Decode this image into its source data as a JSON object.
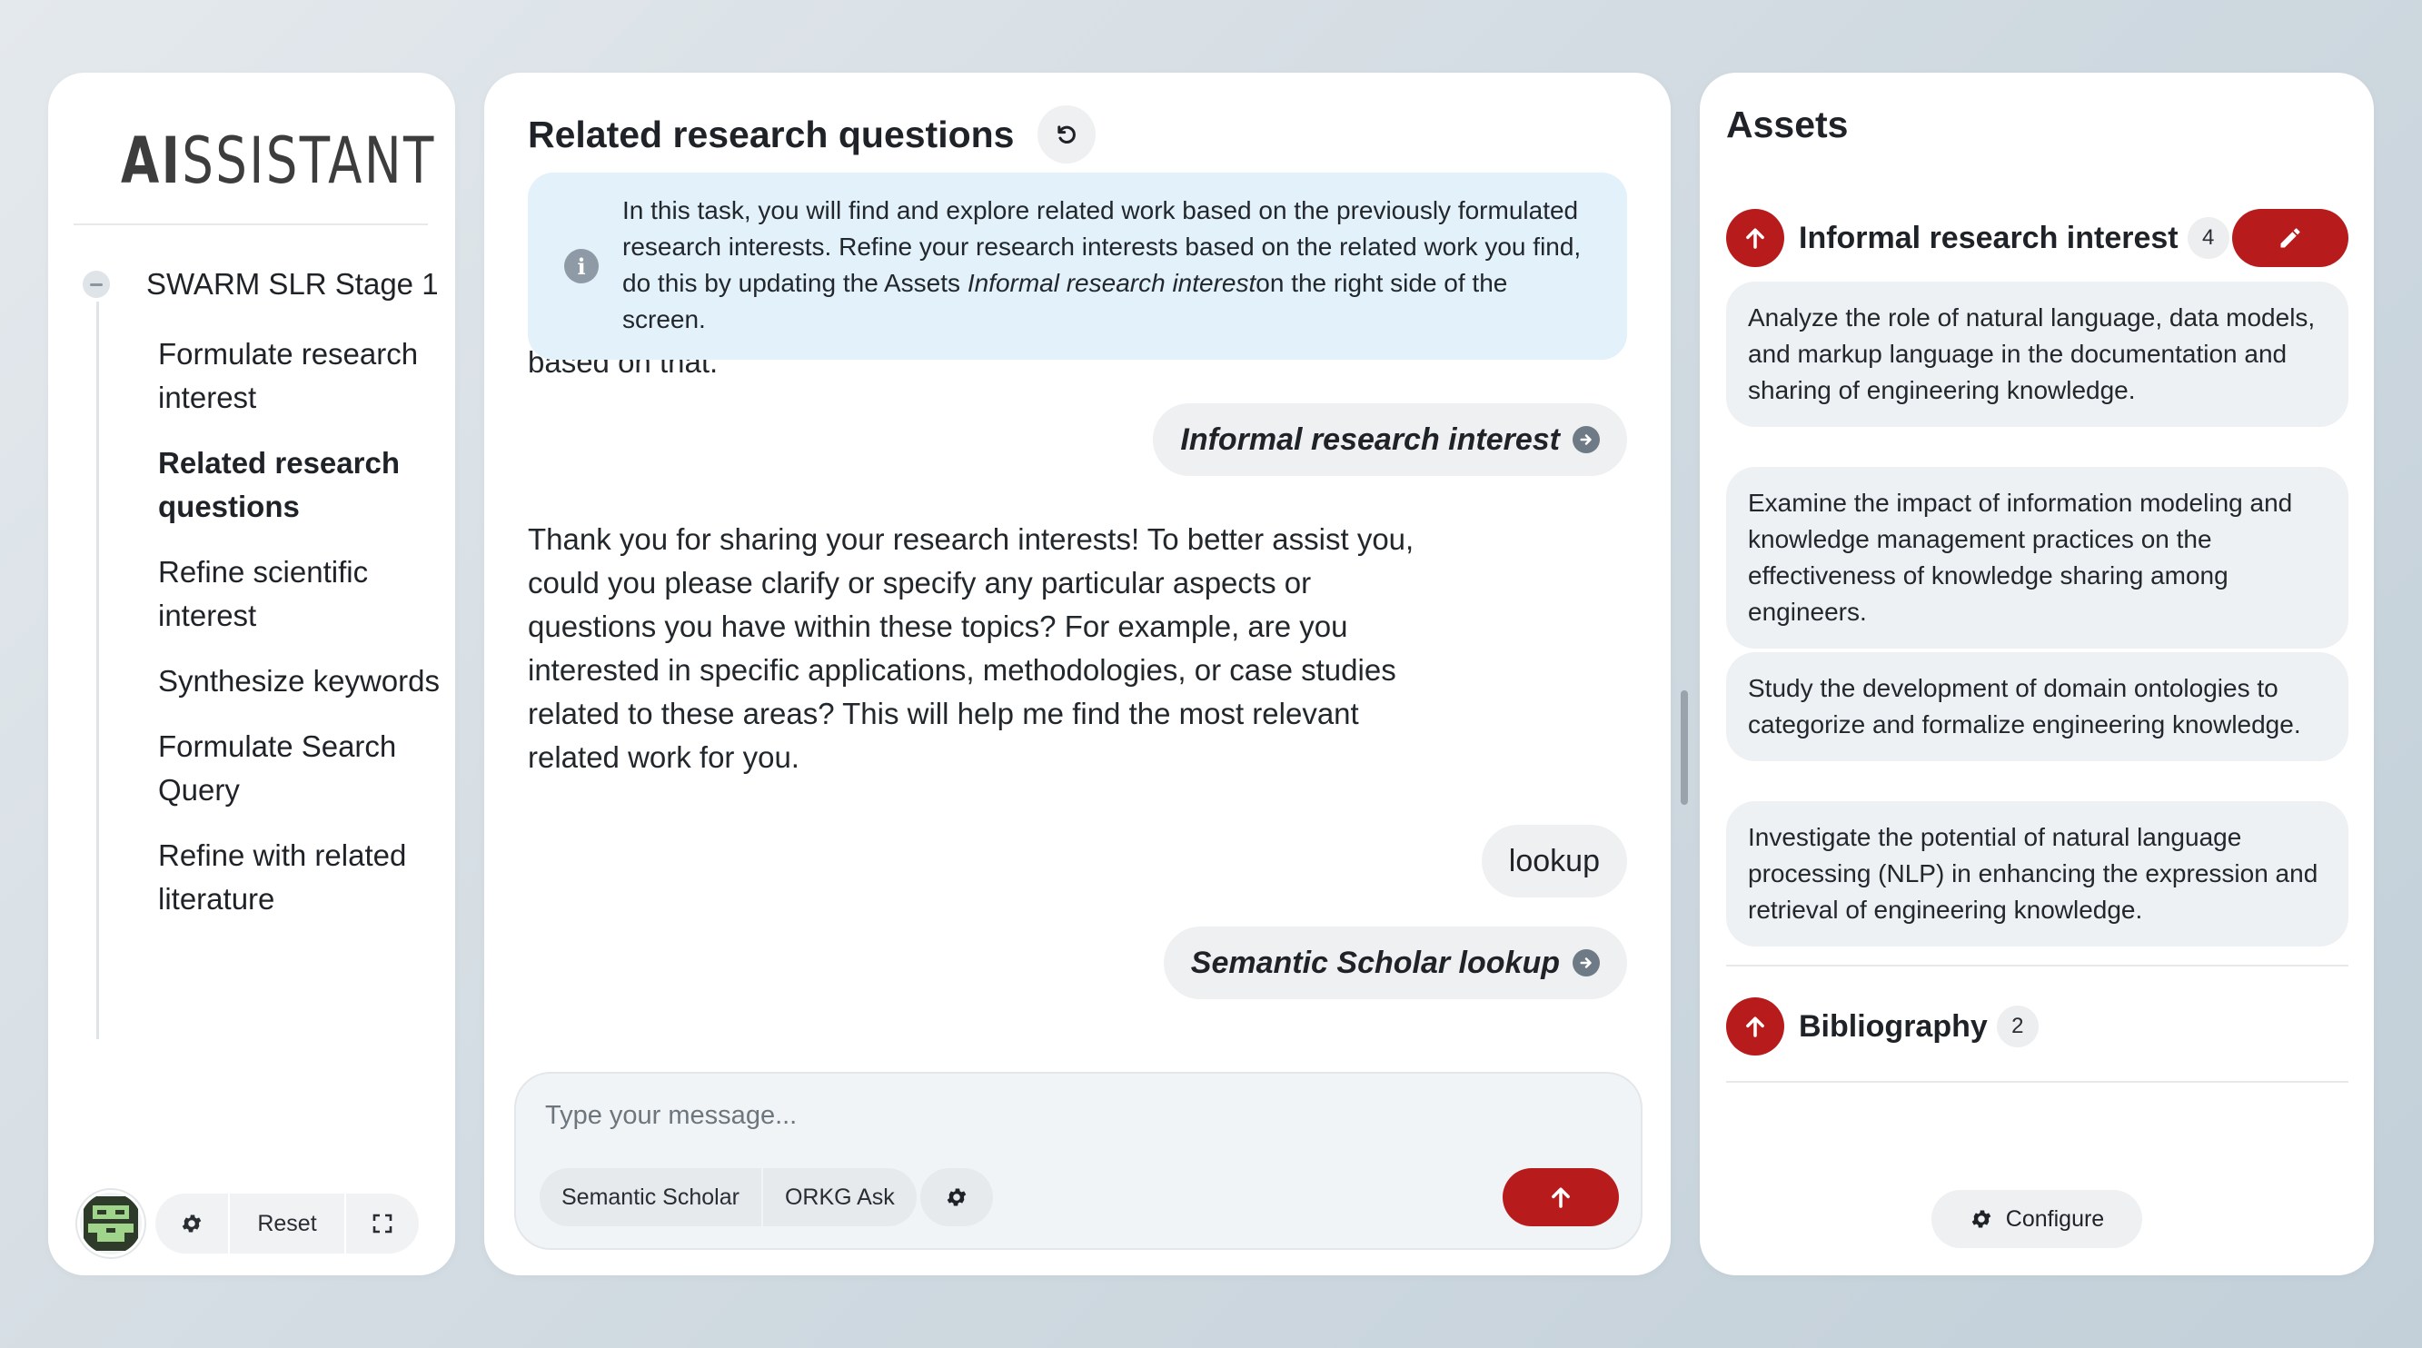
{
  "sidebar": {
    "logo_strong": "AI",
    "logo_rest": "SSISTANT",
    "stage_title": "SWARM SLR Stage 1",
    "steps": [
      {
        "label": "Formulate research interest"
      },
      {
        "label": "Related research questions"
      },
      {
        "label": "Refine scientific interest"
      },
      {
        "label": "Synthesize keywords"
      },
      {
        "label": "Formulate Search Query"
      },
      {
        "label": "Refine with related literature"
      }
    ],
    "active_step": 1,
    "reset_label": "Reset"
  },
  "main": {
    "title": "Related research questions",
    "info_text_part1": "In this task, you will find and explore related work based on the previously formulated research interests. Refine your research interests based on the related work you find, do this by updating the Assets ",
    "info_text_italic": "Informal research interest",
    "info_text_part2": "on the right side of the screen.",
    "cut_text": "based on that.",
    "messages": {
      "asset_chip_1": "Informal research interest",
      "assistant_reply": "Thank you for sharing your research interests! To better assist you, could you please clarify or specify any particular aspects or questions you have within these topics? For example, are you interested in specific applications, methodologies, or case studies related to these areas? This will help me find the most relevant related work for you.",
      "user_reply": "lookup",
      "asset_chip_2": "Semantic Scholar lookup"
    },
    "composer": {
      "placeholder": "Type your message...",
      "tools": [
        "Semantic Scholar",
        "ORKG Ask"
      ]
    }
  },
  "assets": {
    "title": "Assets",
    "informal": {
      "name": "Informal research interest",
      "count": "4",
      "items": [
        "Analyze the role of natural language, data models, and markup language in the documentation and sharing of engineering knowledge.",
        "Examine the impact of information modeling and knowledge management practices on the effectiveness of knowledge sharing among engineers.",
        "Study the development of domain ontologies to categorize and formalize engineering knowledge.",
        "Investigate the potential of natural language processing (NLP) in enhancing the expression and retrieval of engineering knowledge."
      ]
    },
    "bibliography": {
      "name": "Bibliography",
      "count": "2"
    },
    "configure_label": "Configure"
  },
  "colors": {
    "accent_red": "#b81b1b",
    "info_bg": "#e3f1fb",
    "chip_bg": "#eef0f2"
  },
  "icons": {
    "refresh": "refresh-icon",
    "info": "info-icon",
    "gear": "gear-icon",
    "expand": "expand-icon",
    "send": "arrow-up-icon",
    "edit": "pencil-icon",
    "arrow_right": "arrow-right-circle-icon"
  }
}
